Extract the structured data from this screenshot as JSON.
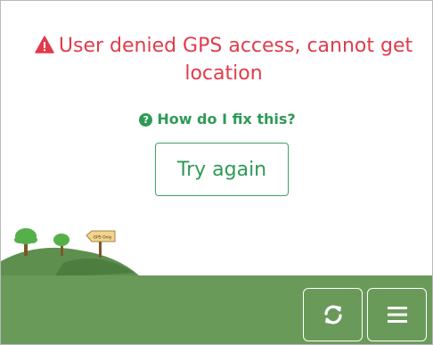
{
  "error": {
    "icon": "warning-triangle-icon",
    "message": "User denied GPS access, cannot get location"
  },
  "help": {
    "icon": "question-circle-icon",
    "glyph": "?",
    "label": "How do I fix this?"
  },
  "actions": {
    "try_again_label": "Try again"
  },
  "scene": {
    "signpost_text": "GPS Only"
  },
  "controls": {
    "refresh_icon": "refresh-icon",
    "menu_icon": "hamburger-menu-icon"
  },
  "colors": {
    "error": "#e13b4b",
    "accent": "#2f9a57",
    "ground": "#6a9a5a"
  }
}
